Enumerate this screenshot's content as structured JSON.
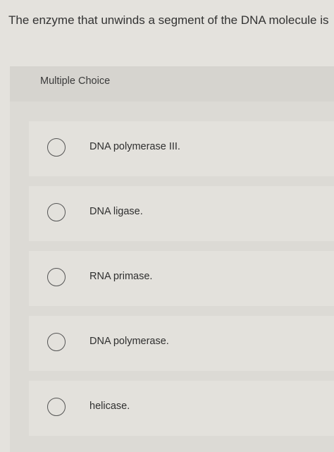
{
  "question": {
    "text": "The enzyme that unwinds a segment of the DNA molecule is"
  },
  "multiple_choice": {
    "header_label": "Multiple Choice",
    "options": [
      {
        "label": "DNA polymerase III."
      },
      {
        "label": "DNA ligase."
      },
      {
        "label": "RNA primase."
      },
      {
        "label": "DNA polymerase."
      },
      {
        "label": "helicase."
      }
    ]
  }
}
